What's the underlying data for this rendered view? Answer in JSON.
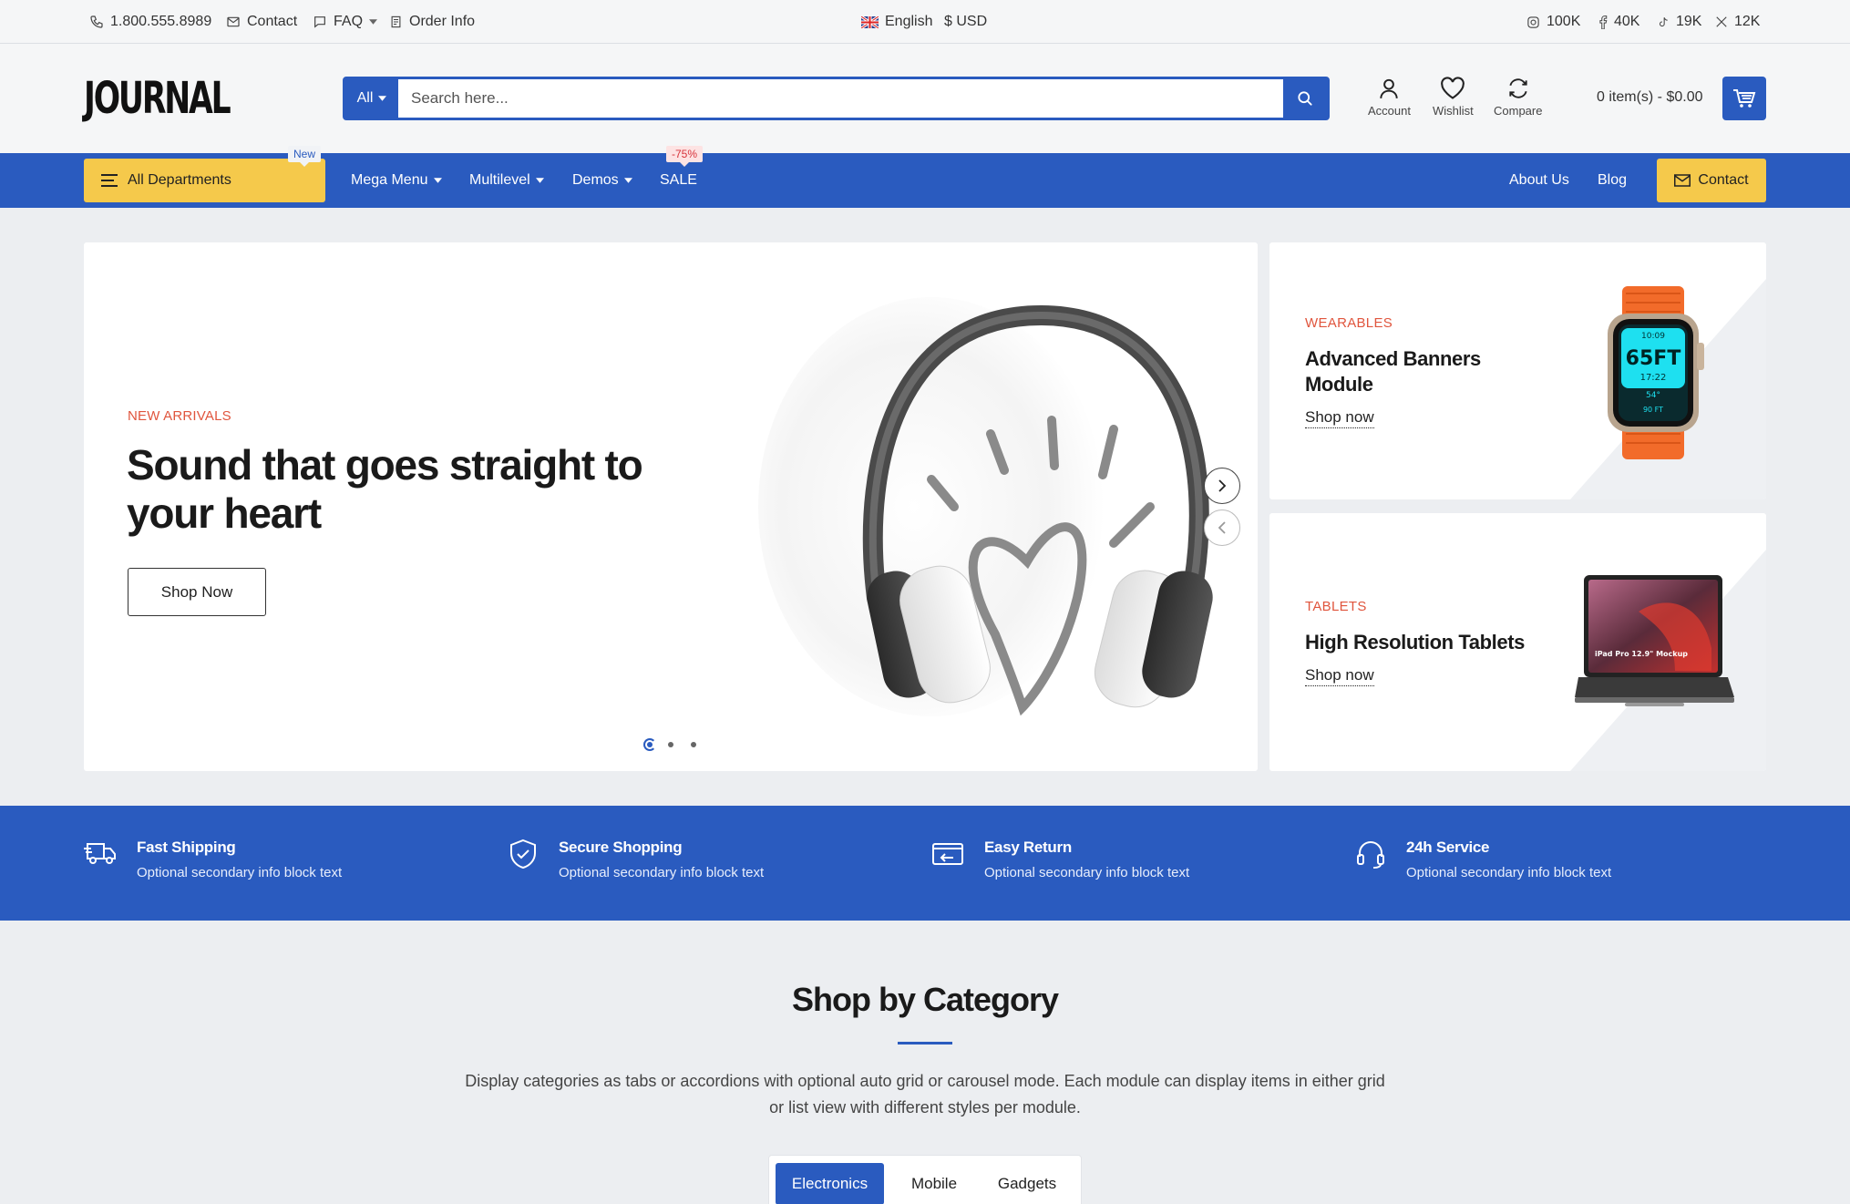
{
  "topbar": {
    "phone": "1.800.555.8989",
    "contact": "Contact",
    "faq": "FAQ",
    "order_info": "Order Info",
    "language": "English",
    "currency": "$ USD",
    "social": {
      "instagram": "100K",
      "facebook": "40K",
      "tiktok": "19K",
      "x": "12K"
    }
  },
  "header": {
    "logo": "JOURNAL",
    "search": {
      "category": "All",
      "placeholder": "Search here..."
    },
    "account": "Account",
    "wishlist": "Wishlist",
    "compare": "Compare",
    "cart": "0 item(s) - $0.00"
  },
  "nav": {
    "all_departments": "All Departments",
    "badge_new": "New",
    "items": [
      "Mega Menu",
      "Multilevel",
      "Demos",
      "SALE"
    ],
    "badge_sale": "-75%",
    "about": "About Us",
    "blog": "Blog",
    "contact": "Contact"
  },
  "hero": {
    "kicker": "NEW ARRIVALS",
    "title": "Sound that goes straight to your heart",
    "button": "Shop Now",
    "active_slide": 1,
    "slide_count": 3
  },
  "banners": [
    {
      "kicker": "WEARABLES",
      "title": "Advanced Banners Module",
      "link": "Shop now",
      "watch_time": "10:09",
      "watch_depth": "65FT",
      "watch_small": "17:22",
      "watch_temp": "54°",
      "watch_max": "90 FT"
    },
    {
      "kicker": "TABLETS",
      "title": "High Resolution Tablets",
      "link": "Shop now",
      "tablet_label": "iPad Pro 12.9\" Mockup"
    }
  ],
  "info": [
    {
      "title": "Fast Shipping",
      "sub": "Optional secondary info block text",
      "icon": "truck-icon"
    },
    {
      "title": "Secure Shopping",
      "sub": "Optional secondary info block text",
      "icon": "shield-check-icon"
    },
    {
      "title": "Easy Return",
      "sub": "Optional secondary info block text",
      "icon": "return-icon"
    },
    {
      "title": "24h Service",
      "sub": "Optional secondary info block text",
      "icon": "headset-icon"
    }
  ],
  "category": {
    "title": "Shop by Category",
    "desc": "Display categories as tabs or accordions with optional auto grid or carousel mode. Each module can display items in either grid or list view with different styles per module.",
    "tabs": [
      "Electronics",
      "Mobile",
      "Gadgets"
    ]
  },
  "colors": {
    "primary": "#2a5bbf",
    "accent": "#f5c94b",
    "kicker": "#e0553d"
  }
}
